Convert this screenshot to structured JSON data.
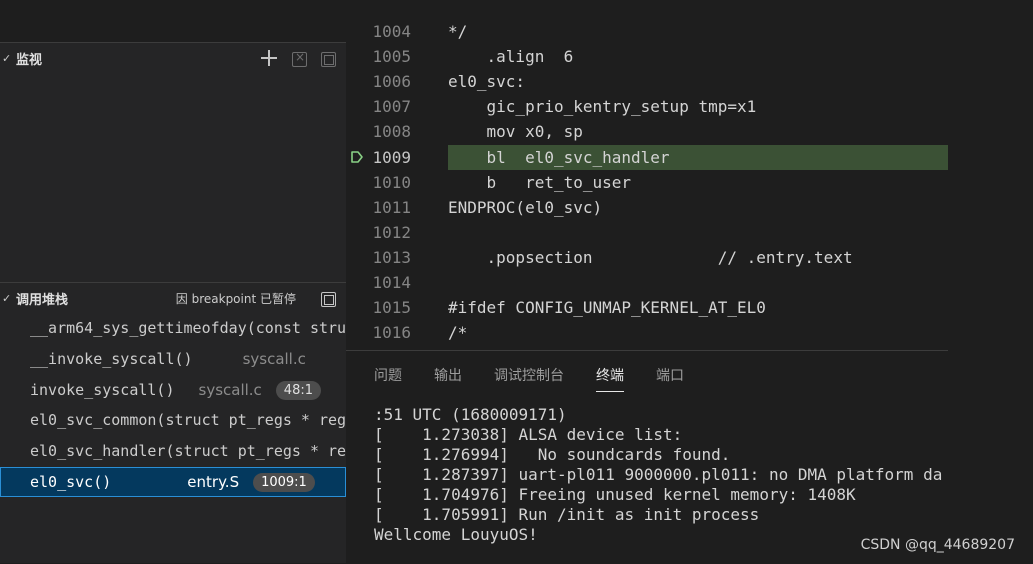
{
  "watch": {
    "title": "监视",
    "chevron": "✓"
  },
  "callstack": {
    "title": "调用堆栈",
    "chevron": "✓",
    "pause_reason": "因 breakpoint 已暂停",
    "frames": [
      {
        "fn": "__arm64_sys_gettimeofday(const stru",
        "file": "",
        "pos": ""
      },
      {
        "fn": "__invoke_syscall()",
        "file": "syscall.c",
        "pos": ""
      },
      {
        "fn": "invoke_syscall()",
        "file": "syscall.c",
        "pos": "48:1"
      },
      {
        "fn": "el0_svc_common(struct pt_regs * reg",
        "file": "",
        "pos": ""
      },
      {
        "fn": "el0_svc_handler(struct pt_regs * re",
        "file": "",
        "pos": ""
      },
      {
        "fn": "el0_svc()",
        "file": "entry.S",
        "pos": "1009:1"
      }
    ]
  },
  "editor": {
    "lines": [
      {
        "num": "1004",
        "code": "*/"
      },
      {
        "num": "1005",
        "code": "    .align  6"
      },
      {
        "num": "1006",
        "code": "el0_svc:"
      },
      {
        "num": "1007",
        "code": "    gic_prio_kentry_setup tmp=x1"
      },
      {
        "num": "1008",
        "code": "    mov x0, sp"
      },
      {
        "num": "1009",
        "code": "    bl  el0_svc_handler"
      },
      {
        "num": "1010",
        "code": "    b   ret_to_user"
      },
      {
        "num": "1011",
        "code": "ENDPROC(el0_svc)"
      },
      {
        "num": "1012",
        "code": ""
      },
      {
        "num": "1013",
        "code": "    .popsection             // .entry.text"
      },
      {
        "num": "1014",
        "code": ""
      },
      {
        "num": "1015",
        "code": "#ifdef CONFIG_UNMAP_KERNEL_AT_EL0"
      },
      {
        "num": "1016",
        "code": "/*"
      }
    ]
  },
  "panel": {
    "tabs": [
      "问题",
      "输出",
      "调试控制台",
      "终端",
      "端口"
    ],
    "terminal": [
      ":51 UTC (1680009171)",
      "[    1.273038] ALSA device list:",
      "[    1.276994]   No soundcards found.",
      "[    1.287397] uart-pl011 9000000.pl011: no DMA platform da",
      "[    1.704976] Freeing unused kernel memory: 1408K",
      "[    1.705991] Run /init as init process",
      "Wellcome LouyuOS!"
    ]
  },
  "watermark": "CSDN @qq_44689207",
  "icons": [
    "add-expression-icon",
    "remove-all-icon",
    "collapse-all-icon",
    "collapse-stack-icon",
    "breakpoint-arrow-icon"
  ],
  "colors": {
    "current_line_bg": "#3b5135",
    "selected_frame_bg": "#04395e",
    "breakpoint": "#89d185"
  }
}
